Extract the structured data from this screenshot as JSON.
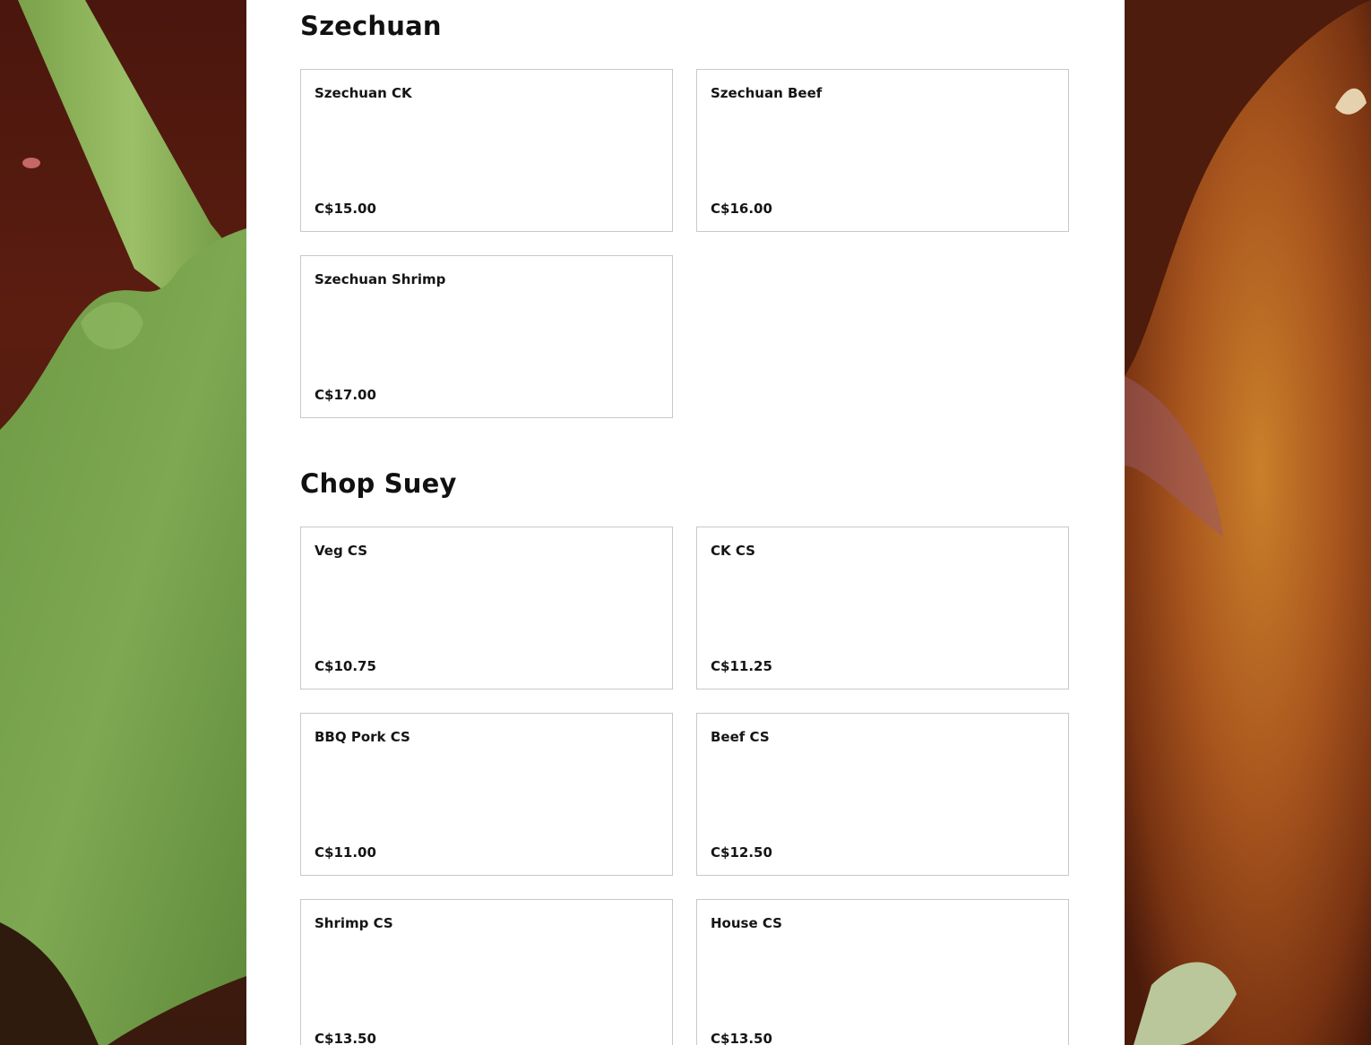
{
  "sections": [
    {
      "title": "Szechuan",
      "items": [
        {
          "name": "Szechuan CK",
          "price": "C$15.00"
        },
        {
          "name": "Szechuan Beef",
          "price": "C$16.00"
        },
        {
          "name": "Szechuan Shrimp",
          "price": "C$17.00"
        }
      ]
    },
    {
      "title": "Chop Suey",
      "items": [
        {
          "name": "Veg CS",
          "price": "C$10.75"
        },
        {
          "name": "CK CS",
          "price": "C$11.25"
        },
        {
          "name": "BBQ Pork CS",
          "price": "C$11.00"
        },
        {
          "name": "Beef CS",
          "price": "C$12.50"
        },
        {
          "name": "Shrimp CS",
          "price": "C$13.50"
        },
        {
          "name": "House CS",
          "price": "C$13.50"
        }
      ]
    }
  ]
}
